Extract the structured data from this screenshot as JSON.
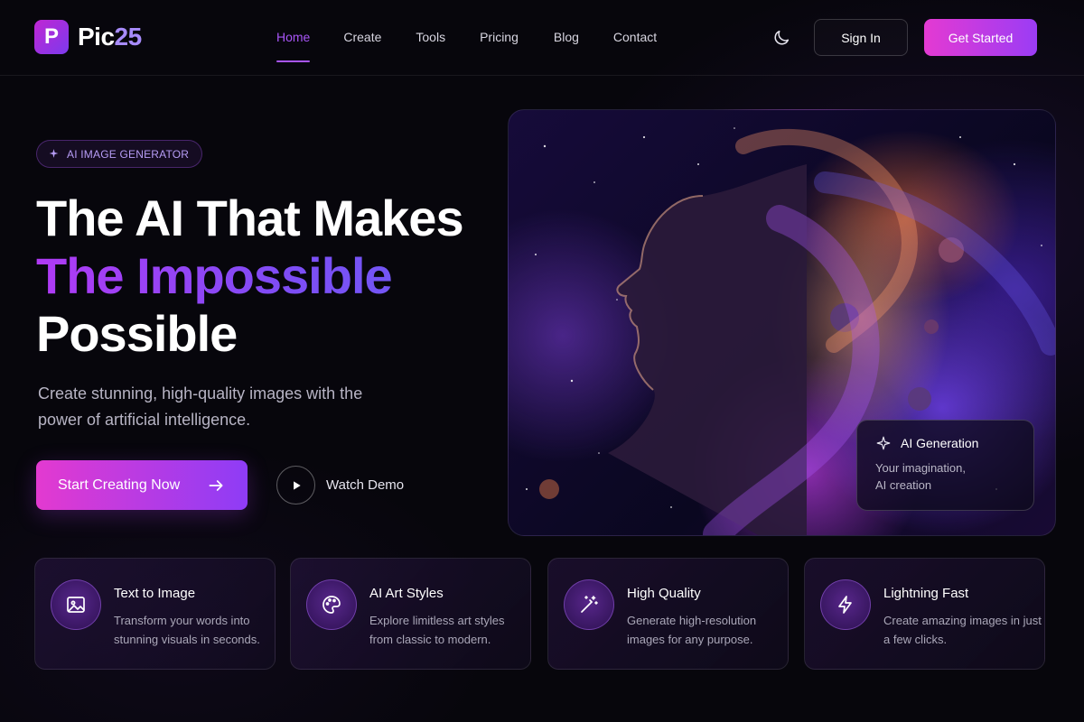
{
  "brand": {
    "name": "Pic",
    "number": "25",
    "logo_letter": "P"
  },
  "nav": {
    "links": [
      "Home",
      "Create",
      "Tools",
      "Pricing",
      "Blog",
      "Contact"
    ],
    "active": "Home",
    "sign_in": "Sign In",
    "get_started": "Get Started"
  },
  "hero": {
    "badge": "AI IMAGE GENERATOR",
    "headline_line1": "The AI That Makes",
    "headline_line2": "The Impossible",
    "headline_line3": "Possible",
    "subtitle": "Create stunning, high-quality images with the power of artificial intelligence.",
    "primary_cta": "Start Creating Now",
    "secondary_cta": "Watch Demo"
  },
  "ai_card": {
    "title": "AI Generation",
    "description_line1": "Your imagination,",
    "description_line2": "AI creation"
  },
  "features": [
    {
      "icon": "image-icon",
      "title": "Text to Image",
      "description": "Transform your words into stunning visuals in seconds."
    },
    {
      "icon": "palette-icon",
      "title": "AI Art Styles",
      "description": "Explore limitless art styles from classic to modern."
    },
    {
      "icon": "magic-wand-icon",
      "title": "High Quality",
      "description": "Generate high-resolution images for any purpose."
    },
    {
      "icon": "lightning-icon",
      "title": "Lightning Fast",
      "description": "Create amazing images in just a few clicks."
    }
  ],
  "colors": {
    "background": "#07060c",
    "accent_pink": "#e43ad2",
    "accent_purple": "#9b3cf5",
    "active_link": "#a855f7"
  }
}
